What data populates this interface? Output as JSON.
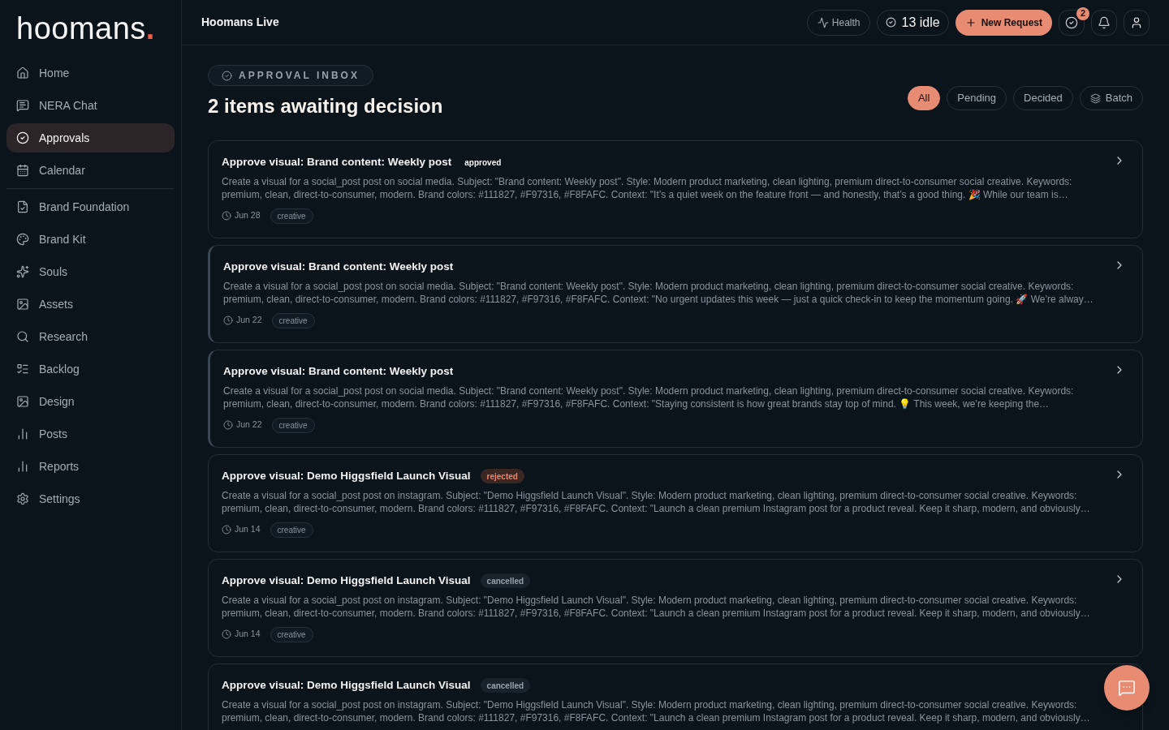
{
  "logo": {
    "name": "hoomans",
    "dot": "."
  },
  "sidebar": {
    "groups": [
      [
        {
          "label": "Home",
          "selected": false
        },
        {
          "label": "NERA Chat",
          "selected": false
        },
        {
          "label": "Approvals",
          "selected": true
        },
        {
          "label": "Calendar",
          "selected": false
        }
      ],
      [
        {
          "label": "Brand Foundation",
          "selected": false
        },
        {
          "label": "Brand Kit",
          "selected": false
        },
        {
          "label": "Souls",
          "selected": false
        },
        {
          "label": "Assets",
          "selected": false
        },
        {
          "label": "Research",
          "selected": false
        },
        {
          "label": "Backlog",
          "selected": false
        },
        {
          "label": "Design",
          "selected": false
        },
        {
          "label": "Posts",
          "selected": false
        },
        {
          "label": "Reports",
          "selected": false
        },
        {
          "label": "Settings",
          "selected": false
        }
      ]
    ]
  },
  "header": {
    "title": "Hoomans Live",
    "health_button": "Health",
    "idle_status": "13 idle",
    "new_request_button": "New Request",
    "approvals_count": "2"
  },
  "page": {
    "eyebrow": "APPROVAL INBOX",
    "heading": "2 items awaiting decision",
    "filters": [
      {
        "label": "All",
        "selected": true
      },
      {
        "label": "Pending",
        "selected": false
      },
      {
        "label": "Decided",
        "selected": false
      }
    ],
    "batch_button": "Batch"
  },
  "cards": [
    {
      "kind": "approved",
      "title": "Approve visual: Brand content: Weekly post",
      "badge": "approved",
      "description": "Create a visual for a social_post post on social media. Subject: \"Brand content: Weekly post\". Style: Modern product marketing, clean lighting, premium direct-to-consumer social creative. Keywords: premium, clean, direct-to-consumer, modern. Brand colors: #111827, #F97316, #F8FAFC. Context: \"It’s a quiet week on the feature front — and honestly, that’s a good thing. 🎉 While our team is…",
      "date": "Jun 28",
      "tag": "creative"
    },
    {
      "kind": "pending",
      "title": "Approve visual: Brand content: Weekly post",
      "description": "Create a visual for a social_post post on social media. Subject: \"Brand content: Weekly post\". Style: Modern product marketing, clean lighting, premium direct-to-consumer social creative. Keywords: premium, clean, direct-to-consumer, modern. Brand colors: #111827, #F97316, #F8FAFC. Context: \"No urgent updates this week — just a quick check-in to keep the momentum going. 🚀 We’re alway…",
      "date": "Jun 22",
      "tag": "creative"
    },
    {
      "kind": "pending",
      "title": "Approve visual: Brand content: Weekly post",
      "description": "Create a visual for a social_post post on social media. Subject: \"Brand content: Weekly post\". Style: Modern product marketing, clean lighting, premium direct-to-consumer social creative. Keywords: premium, clean, direct-to-consumer, modern. Brand colors: #111827, #F97316, #F8FAFC. Context: \"Staying consistent is how great brands stay top of mind. 💡 This week, we’re keeping the…",
      "date": "Jun 22",
      "tag": "creative"
    },
    {
      "kind": "rejected",
      "title": "Approve visual: Demo Higgsfield Launch Visual",
      "badge": "rejected",
      "description": "Create a visual for a social_post post on instagram. Subject: \"Demo Higgsfield Launch Visual\". Style: Modern product marketing, clean lighting, premium direct-to-consumer social creative. Keywords: premium, clean, direct-to-consumer, modern. Brand colors: #111827, #F97316, #F8FAFC. Context: \"Launch a clean premium Instagram post for a product reveal. Keep it sharp, modern, and obviously…",
      "date": "Jun 14",
      "tag": "creative"
    },
    {
      "kind": "cancelled",
      "title": "Approve visual: Demo Higgsfield Launch Visual",
      "badge": "cancelled",
      "description": "Create a visual for a social_post post on instagram. Subject: \"Demo Higgsfield Launch Visual\". Style: Modern product marketing, clean lighting, premium direct-to-consumer social creative. Keywords: premium, clean, direct-to-consumer, modern. Brand colors: #111827, #F97316, #F8FAFC. Context: \"Launch a clean premium Instagram post for a product reveal. Keep it sharp, modern, and obviously…",
      "date": "Jun 14",
      "tag": "creative"
    },
    {
      "kind": "cancelled",
      "title": "Approve visual: Demo Higgsfield Launch Visual",
      "badge": "cancelled",
      "description": "Create a visual for a social_post post on instagram. Subject: \"Demo Higgsfield Launch Visual\". Style: Modern product marketing, clean lighting, premium direct-to-consumer social creative. Keywords: premium, clean, direct-to-consumer, modern. Brand colors: #111827, #F97316, #F8FAFC. Context: \"Launch a clean premium Instagram post for a product reveal. Keep it sharp, modern, and obviously…"
    }
  ]
}
